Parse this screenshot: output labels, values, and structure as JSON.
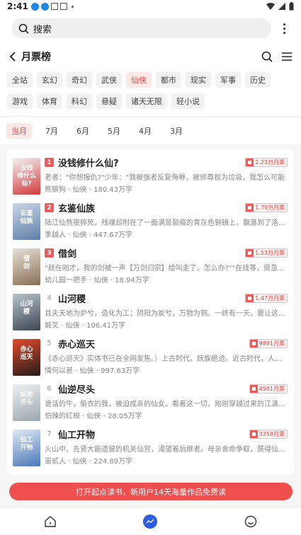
{
  "status_bar": {
    "time": "2:41"
  },
  "search": {
    "placeholder": "搜索"
  },
  "nav": {
    "title": "月票榜"
  },
  "genres": [
    {
      "label": "全站",
      "active": false
    },
    {
      "label": "玄幻",
      "active": false
    },
    {
      "label": "奇幻",
      "active": false
    },
    {
      "label": "武侠",
      "active": false
    },
    {
      "label": "仙侠",
      "active": true
    },
    {
      "label": "都市",
      "active": false
    },
    {
      "label": "现实",
      "active": false
    },
    {
      "label": "军事",
      "active": false
    },
    {
      "label": "历史",
      "active": false
    },
    {
      "label": "游戏",
      "active": false
    },
    {
      "label": "体育",
      "active": false
    },
    {
      "label": "科幻",
      "active": false
    },
    {
      "label": "悬疑",
      "active": false
    },
    {
      "label": "诸天无限",
      "active": false
    },
    {
      "label": "轻小说",
      "active": false
    }
  ],
  "months": [
    {
      "label": "当月",
      "active": true
    },
    {
      "label": "7月",
      "active": false
    },
    {
      "label": "6月",
      "active": false
    },
    {
      "label": "5月",
      "active": false
    },
    {
      "label": "4月",
      "active": false
    },
    {
      "label": "3月",
      "active": false
    }
  ],
  "books": [
    {
      "rank": "1",
      "title": "没钱修什么仙?",
      "desc": "老者：\"你想报仇?\"少年：\"我被强者反复侮辱，被师尊视为垃圾，我怎么可能...",
      "author": "熊狼狗",
      "genre": "仙侠",
      "words": "180.43万字",
      "votes": "2.23万月票",
      "cover_colors": [
        "#f3f3f3",
        "#d23a3a"
      ],
      "cover_text": "没钱\n修什么仙?"
    },
    {
      "rank": "2",
      "title": "玄鉴仙族",
      "desc": "陆江仙熬夜猝死，残魂却附在了一面满是裂痕的青灰色铜镜上，飘落到了洛...",
      "author": "季越人",
      "genre": "仙侠",
      "words": "447.67万字",
      "votes": "1.79万月票",
      "cover_colors": [
        "#c9d6e6",
        "#5e7ea8"
      ],
      "cover_text": "玄鉴\n仙族"
    },
    {
      "rank": "3",
      "title": "借剑",
      "desc": "\"就在刚才，我的剑被一声【万剑归宗】给叫走了，怎么办?\"\"在线等，挺急...",
      "author": "幼儿园一把手",
      "genre": "仙侠",
      "words": "18.94万字",
      "votes": "1.53万月票",
      "cover_colors": [
        "#e6e1d6",
        "#8a6e55"
      ],
      "cover_text": "借\n剑"
    },
    {
      "rank": "4",
      "title": "山河稷",
      "desc": "且夫天地为炉兮，造化为工；阴阳为炭兮，万物为铜。一终有一天，要让这...",
      "author": "姬叉",
      "genre": "仙侠",
      "words": "106.41万字",
      "votes": "1.47万月票",
      "cover_colors": [
        "#b9c3cc",
        "#3c4650"
      ],
      "cover_text": "山河\n稷"
    },
    {
      "rank": "5",
      "title": "赤心巡天",
      "desc": "《赤心巡天》实体书已在全网发售。）上古时代，妖族绝迹。近古时代，人...",
      "author": "情何以甚",
      "genre": "仙侠",
      "words": "997.63万字",
      "votes": "9891月票",
      "cover_colors": [
        "#e34b2b",
        "#221a1a"
      ],
      "cover_text": "赤心\n巡天"
    },
    {
      "rank": "6",
      "title": "仙逆尽头",
      "desc": "诡话的牛，偷衣的我，被迫成亲的仙女。看着这一切，刚刚穿越过来的江漓...",
      "author": "怕辣的红椒",
      "genre": "仙侠",
      "words": "28.05万字",
      "votes": "4581月票",
      "cover_colors": [
        "#eef1f2",
        "#9aa6ad"
      ],
      "cover_text": "仙逆\n尽头"
    },
    {
      "rank": "7",
      "title": "仙工开物",
      "desc": "火山中，先贤大能遗留的机关仙宫，渴望着后继者。母亲舍命争取，获得仙...",
      "author": "宙贰人",
      "genre": "仙侠",
      "words": "224.89万字",
      "votes": "3258月票",
      "cover_colors": [
        "#dfe9f5",
        "#4a77b8"
      ],
      "cover_text": "仙工\n开物"
    }
  ],
  "cta": {
    "label": "打开起点读书，新用户14天海量作品免费读"
  },
  "colors": {
    "accent": "#e54545",
    "cta": "#ef4f4f",
    "find": "#2f5fe0"
  },
  "icons": [
    "search-icon",
    "back-arrow-icon",
    "menu-icon",
    "more-vert-icon",
    "home-icon",
    "find-icon",
    "smile-icon"
  ]
}
